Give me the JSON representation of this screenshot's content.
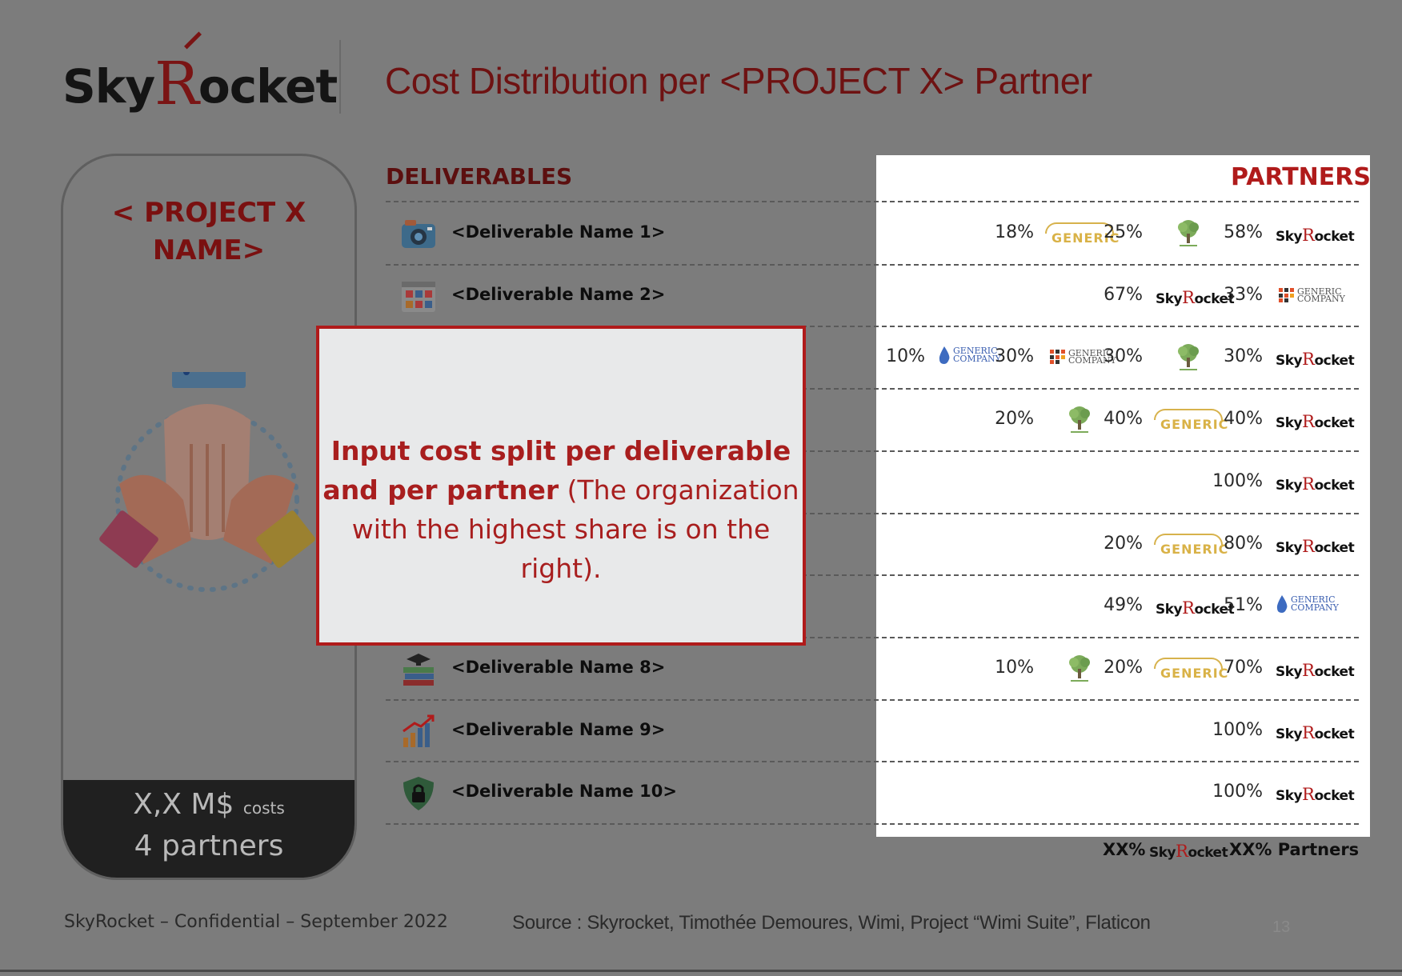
{
  "header": {
    "brand": {
      "part1": "Sky",
      "part2": "R",
      "part3": "ocket"
    },
    "title": "Cost Distribution per <PROJECT X> Partner"
  },
  "project_card": {
    "name_line1": "< PROJECT X",
    "name_line2": "NAME>",
    "cost_value": "X,X M$",
    "cost_unit": "costs",
    "partners": "4 partners",
    "illustration": "teamwork-hands-icon"
  },
  "table": {
    "deliverables_heading": "DELIVERABLES",
    "partners_heading": "PARTNERS",
    "rows": [
      {
        "label": "<Deliverable Name 1>",
        "icon": "camera-icon",
        "splits": [
          {
            "pct": "18%",
            "partner": "generic-car-dealer"
          },
          {
            "pct": "25%",
            "partner": "generic-tree-company"
          },
          {
            "pct": "58%",
            "partner": "skyrocket"
          }
        ]
      },
      {
        "label": "<Deliverable Name 2>",
        "icon": "dashboard-icon",
        "splits": [
          {
            "pct": "67%",
            "partner": "skyrocket"
          },
          {
            "pct": "33%",
            "partner": "generic-blocks-company"
          }
        ]
      },
      {
        "label": "",
        "icon": "",
        "splits": [
          {
            "pct": "10%",
            "partner": "generic-drop-company"
          },
          {
            "pct": "30%",
            "partner": "generic-blocks-company"
          },
          {
            "pct": "30%",
            "partner": "generic-tree-company"
          },
          {
            "pct": "30%",
            "partner": "skyrocket"
          }
        ]
      },
      {
        "label": "",
        "icon": "",
        "splits": [
          {
            "pct": "20%",
            "partner": "generic-tree-company"
          },
          {
            "pct": "40%",
            "partner": "generic-car-dealer"
          },
          {
            "pct": "40%",
            "partner": "skyrocket"
          }
        ]
      },
      {
        "label": "",
        "icon": "",
        "splits": [
          {
            "pct": "100%",
            "partner": "skyrocket"
          }
        ]
      },
      {
        "label": "",
        "icon": "",
        "splits": [
          {
            "pct": "20%",
            "partner": "generic-car-dealer"
          },
          {
            "pct": "80%",
            "partner": "skyrocket"
          }
        ]
      },
      {
        "label": "",
        "icon": "",
        "splits": [
          {
            "pct": "49%",
            "partner": "skyrocket"
          },
          {
            "pct": "51%",
            "partner": "generic-drop-company"
          }
        ]
      },
      {
        "label": "<Deliverable Name 8>",
        "icon": "books-icon",
        "splits": [
          {
            "pct": "10%",
            "partner": "generic-tree-company"
          },
          {
            "pct": "20%",
            "partner": "generic-car-dealer"
          },
          {
            "pct": "70%",
            "partner": "skyrocket"
          }
        ]
      },
      {
        "label": "<Deliverable Name 9>",
        "icon": "growth-chart-icon",
        "splits": [
          {
            "pct": "100%",
            "partner": "skyrocket"
          }
        ]
      },
      {
        "label": "<Deliverable Name 10>",
        "icon": "security-shield-icon",
        "splits": [
          {
            "pct": "100%",
            "partner": "skyrocket"
          }
        ]
      }
    ],
    "totals": {
      "left": "XX%",
      "right": "XX% Partners"
    }
  },
  "overlay": {
    "bold_text": "Input cost split per deliverable and per partner",
    "normal_text": " (The organization with the highest share is on the right)."
  },
  "footer": {
    "left": "SkyRocket – Confidential – September 2022",
    "source": "Source : Skyrocket, Timothée Demoures, Wimi, Project “Wimi Suite”, Flaticon",
    "page": "13"
  },
  "colors": {
    "brand_red": "#b01b1b",
    "dark_red": "#6e1212",
    "backdrop": "#7c7c7c",
    "panel": "#ffffff"
  }
}
